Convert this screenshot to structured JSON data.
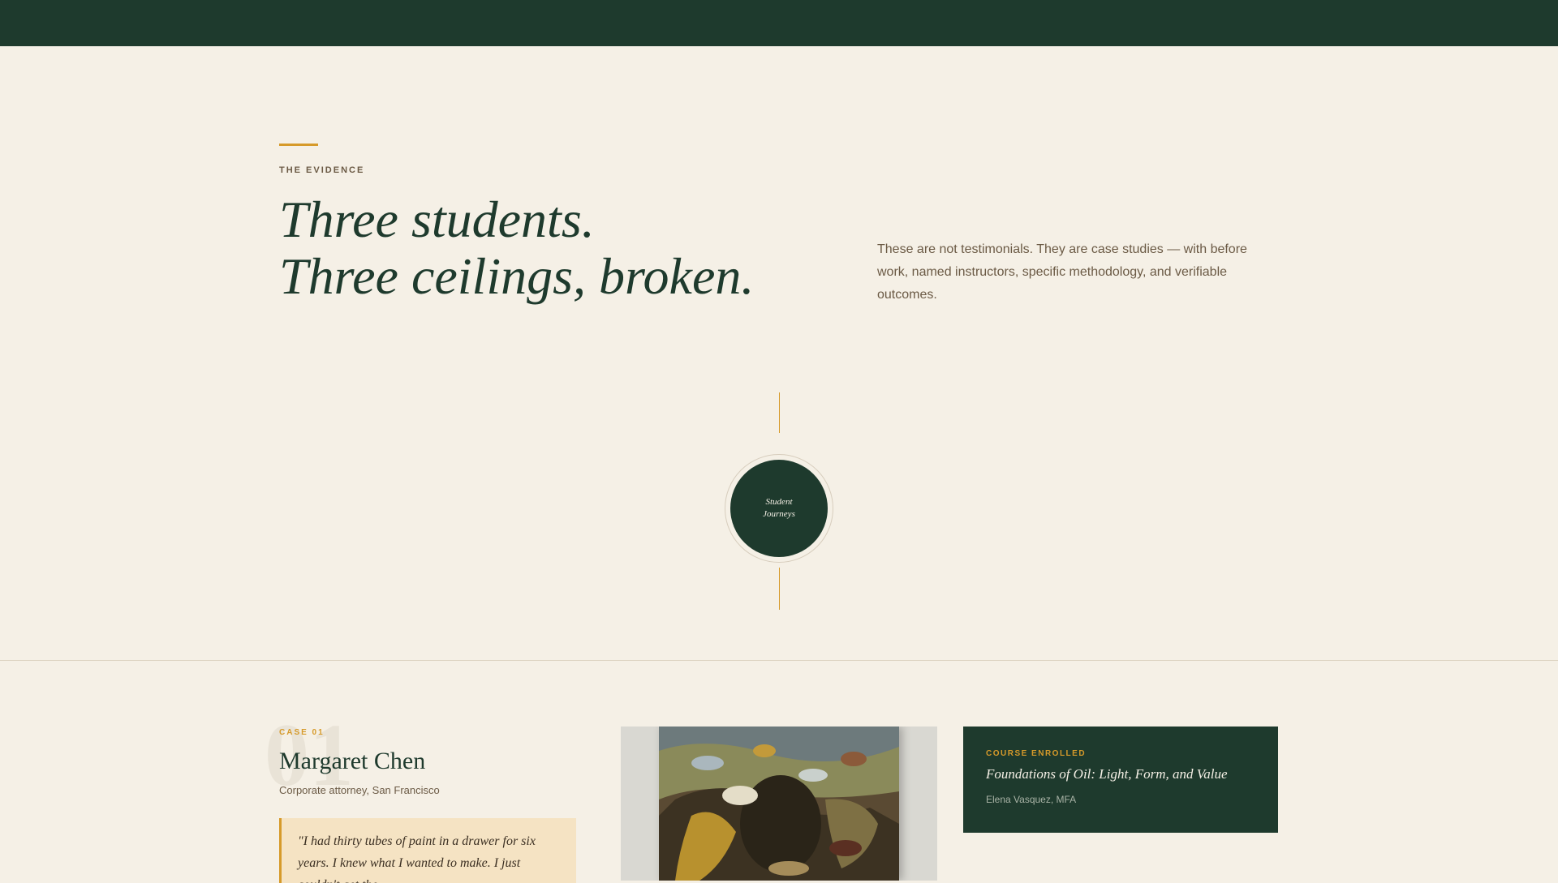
{
  "header": {
    "bar_color": "#1e3a2d"
  },
  "hero": {
    "eyebrow": "THE EVIDENCE",
    "headline_line1": "Three students.",
    "headline_line2": "Three ceilings, broken.",
    "intro": "These are not testimonials. They are case studies — with before work, named instructors, specific methodology, and verifiable outcomes."
  },
  "badge": {
    "line1": "Student",
    "line2": "Journeys"
  },
  "case": {
    "number": "01",
    "label": "CASE 01",
    "name": "Margaret Chen",
    "role": "Corporate attorney, San Francisco",
    "quote": "\"I had thirty tubes of paint in a drawer for six years. I knew what I wanted to make. I just couldn't get the",
    "artwork": {
      "icon": "oil-painting-thumbnail"
    },
    "course": {
      "eyebrow": "COURSE ENROLLED",
      "title": "Foundations of Oil: Light, Form, and Value",
      "instructor": "Elena Vasquez, MFA"
    }
  },
  "colors": {
    "background": "#f5f0e6",
    "primary_green": "#1e3a2d",
    "accent_gold": "#d69a2a",
    "muted_text": "#6b5a45",
    "quote_bg": "#f5e3c3"
  }
}
